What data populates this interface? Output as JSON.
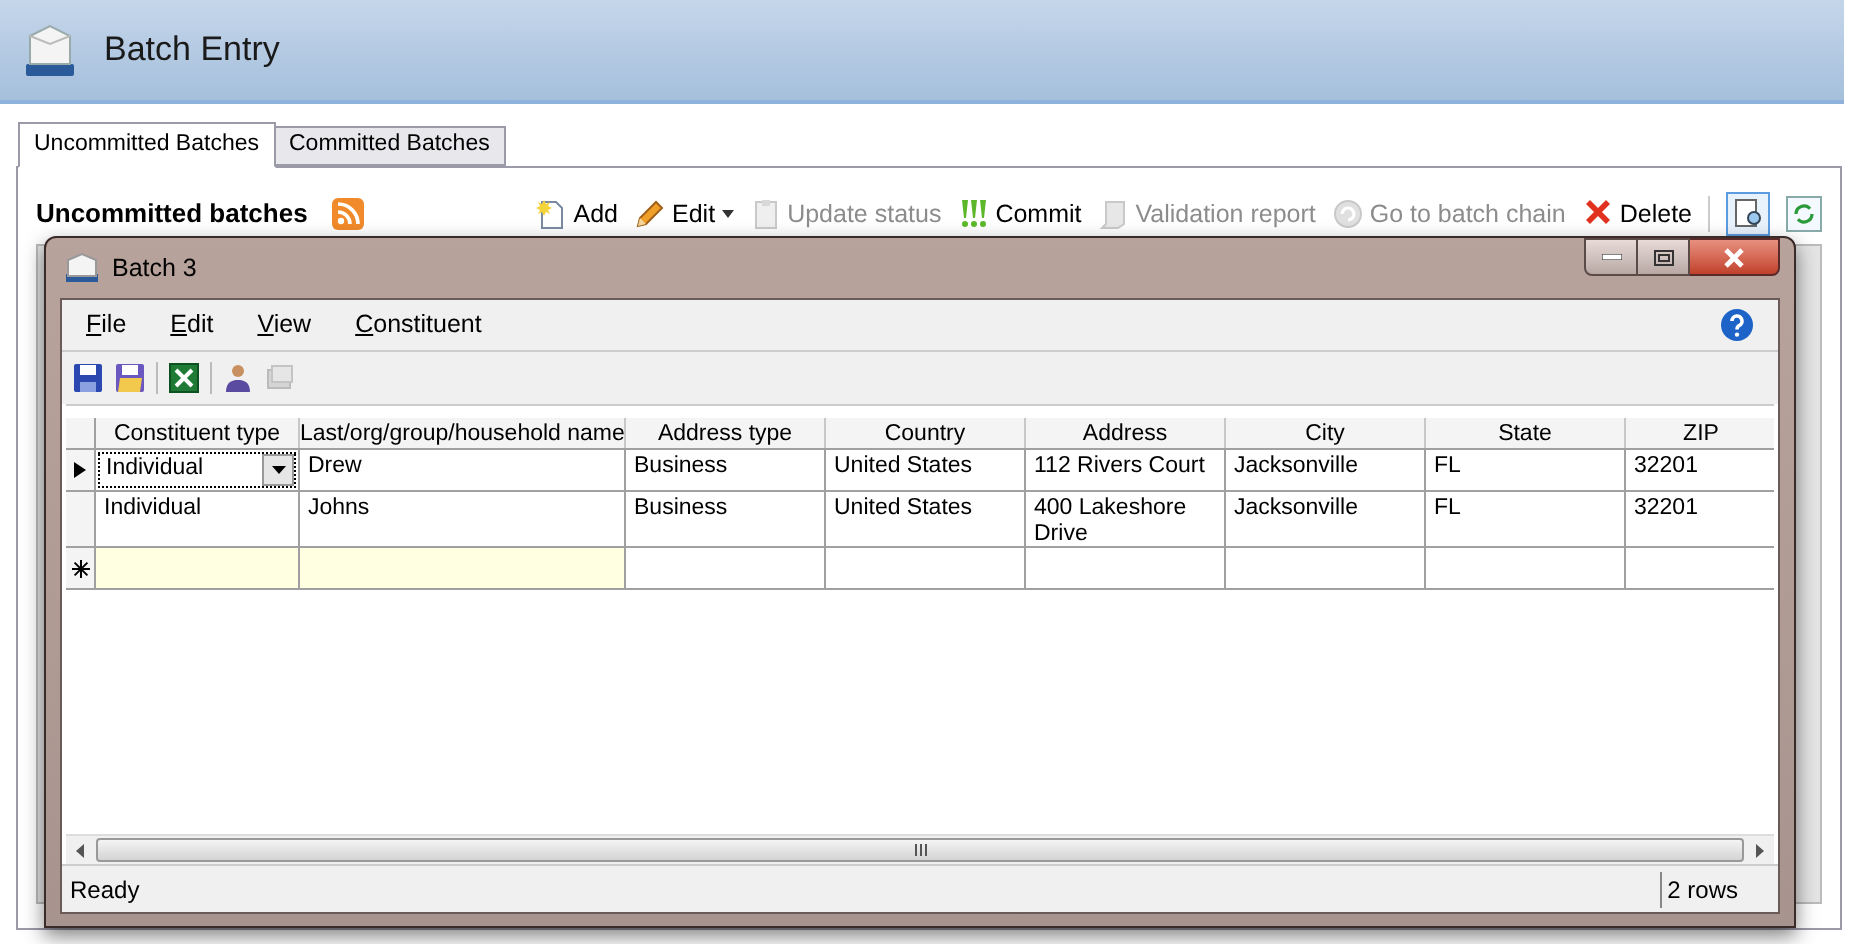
{
  "page": {
    "title": "Batch Entry"
  },
  "tabs": [
    {
      "label": "Uncommitted Batches",
      "selected": true
    },
    {
      "label": "Committed Batches",
      "selected": false
    }
  ],
  "section": {
    "title": "Uncommitted batches"
  },
  "actions": [
    {
      "kind": "add",
      "label": "Add",
      "disabled": false
    },
    {
      "kind": "edit",
      "label": "Edit",
      "disabled": false,
      "dropdown": true
    },
    {
      "kind": "status",
      "label": "Update status",
      "disabled": true
    },
    {
      "kind": "commit",
      "label": "Commit",
      "disabled": false
    },
    {
      "kind": "report",
      "label": "Validation report",
      "disabled": true
    },
    {
      "kind": "chain",
      "label": "Go to batch chain",
      "disabled": true
    },
    {
      "kind": "delete",
      "label": "Delete",
      "disabled": false
    }
  ],
  "dialog": {
    "title": "Batch 3",
    "menu": [
      "File",
      "Edit",
      "View",
      "Constituent"
    ],
    "toolbar": [
      {
        "kind": "save",
        "disabled": false
      },
      {
        "kind": "save-close",
        "disabled": false
      },
      {
        "kind": "excel",
        "disabled": false
      },
      {
        "kind": "person",
        "disabled": false
      },
      {
        "kind": "stack",
        "disabled": true
      }
    ],
    "columns": [
      "Constituent type",
      "Last/org/group/household name",
      "Address type",
      "Country",
      "Address",
      "City",
      "State",
      "ZIP"
    ],
    "rows": [
      {
        "kind": "current",
        "cells": [
          "Individual",
          "Drew",
          "Business",
          "United States",
          "112 Rivers Court",
          "Jacksonville",
          "FL",
          "32201"
        ]
      },
      {
        "kind": "normal",
        "cells": [
          "Individual",
          "Johns",
          "Business",
          "United States",
          "400 Lakeshore Drive",
          "Jacksonville",
          "FL",
          "32201"
        ]
      },
      {
        "kind": "new",
        "cells": []
      }
    ],
    "status": "Ready",
    "row_count": "2 rows"
  }
}
